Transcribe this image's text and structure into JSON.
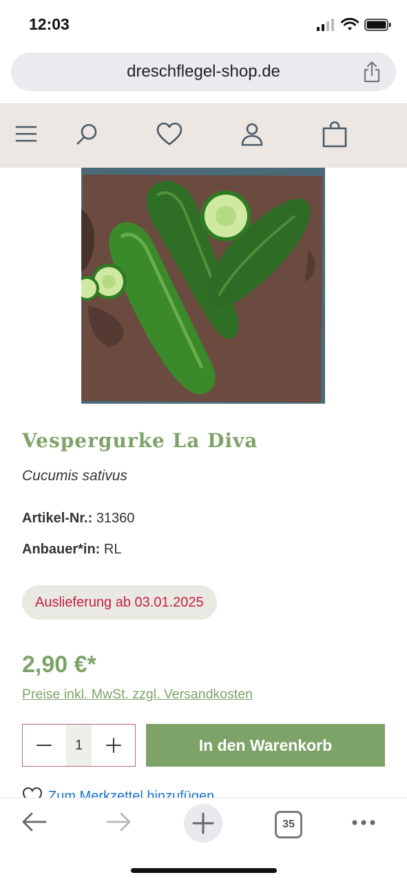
{
  "status_bar": {
    "time": "12:03"
  },
  "browser": {
    "url": "dreschflegel-shop.de",
    "tabs_count": "35"
  },
  "header": {
    "icons": [
      "menu-icon",
      "search-icon",
      "heart-icon",
      "user-icon",
      "bag-icon"
    ]
  },
  "product": {
    "title": "Vespergurke La Diva",
    "latin_name": "Cucumis sativus",
    "article_label": "Artikel-Nr.:",
    "article_number": "31360",
    "grower_label": "Anbauer*in:",
    "grower": "RL",
    "delivery_badge": "Auslieferung ab 03.01.2025",
    "price": "2,90 €*",
    "price_note": "Preise inkl. MwSt. zzgl. Versandkosten",
    "quantity": "1",
    "add_to_cart": "In den Warenkorb",
    "wishlist": "Zum Merkzettel hinzufügen"
  },
  "colors": {
    "brand_green": "#7ea369",
    "badge_red": "#c4213f",
    "header_bg": "#ece7e2",
    "link_blue": "#1a73c9"
  }
}
